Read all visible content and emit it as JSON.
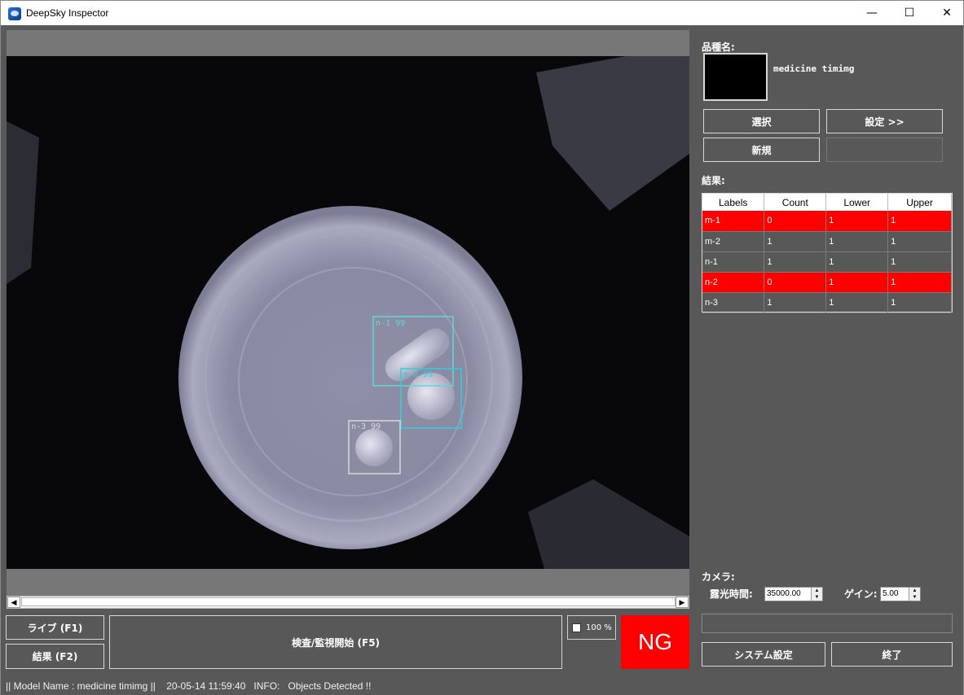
{
  "window": {
    "title": "DeepSky Inspector",
    "minimize_glyph": "—",
    "maximize_glyph": "☐",
    "close_glyph": "✕"
  },
  "detections": [
    {
      "label": "n-1 99",
      "color": "#5fd8d8"
    },
    {
      "label": "m-2 99",
      "color": "#2fd0e0"
    },
    {
      "label": "n-3 99",
      "color": "#d8d8d8"
    }
  ],
  "viewer_controls": {
    "live_label": "ライブ (F1)",
    "result_label": "結果 (F2)",
    "start_label": "検査/監視開始 (F5)",
    "zoom_text": "100 %",
    "verdict": "NG",
    "verdict_color": "#ff0000"
  },
  "model": {
    "section_label": "品種名:",
    "name": "medicine timimg",
    "select_label": "選択",
    "settings_label": "設定 >>",
    "new_label": "新規"
  },
  "results": {
    "section_label": "結果:",
    "columns": [
      "Labels",
      "Count",
      "Lower",
      "Upper"
    ],
    "rows": [
      {
        "label": "m-1",
        "count": "0",
        "lower": "1",
        "upper": "1",
        "ng": true
      },
      {
        "label": "m-2",
        "count": "1",
        "lower": "1",
        "upper": "1",
        "ng": false
      },
      {
        "label": "n-1",
        "count": "1",
        "lower": "1",
        "upper": "1",
        "ng": false
      },
      {
        "label": "n-2",
        "count": "0",
        "lower": "1",
        "upper": "1",
        "ng": true
      },
      {
        "label": "n-3",
        "count": "1",
        "lower": "1",
        "upper": "1",
        "ng": false
      }
    ]
  },
  "camera": {
    "section_label": "カメラ:",
    "exposure_label": "露光時間:",
    "exposure_value": "35000.00",
    "gain_label": "ゲイン:",
    "gain_value": "5.00"
  },
  "footer_buttons": {
    "system_settings_label": "システム設定",
    "exit_label": "終了"
  },
  "status_bar": {
    "text": "|| Model Name : medicine timimg ||    20-05-14 11:59:40   INFO:   Objects Detected !!"
  },
  "colors": {
    "panel_bg": "#585858",
    "ng_row": "#ff0000"
  }
}
